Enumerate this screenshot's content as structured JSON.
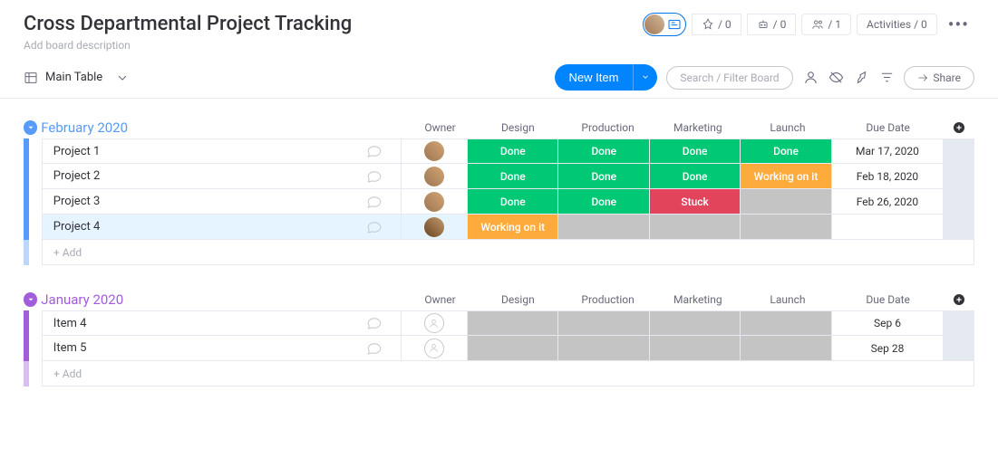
{
  "header": {
    "title": "Cross Departmental Project Tracking",
    "description": "Add board description",
    "stats": {
      "pin": "0",
      "bot": "0",
      "members": "1"
    },
    "activities_label": "Activities / 0"
  },
  "toolbar": {
    "view": "Main Table",
    "new_item": "New Item",
    "search_placeholder": "Search / Filter Board",
    "share": "Share"
  },
  "columns": {
    "owner": "Owner",
    "design": "Design",
    "production": "Production",
    "marketing": "Marketing",
    "launch": "Launch",
    "due_date": "Due Date"
  },
  "status_labels": {
    "done": "Done",
    "working": "Working on it",
    "stuck": "Stuck"
  },
  "common": {
    "add": "+ Add"
  },
  "groups": [
    {
      "id": "feb",
      "name": "February 2020",
      "color_class": "g-feb",
      "rows": [
        {
          "name": "Project 1",
          "owner": "photo1",
          "design": "done",
          "production": "done",
          "marketing": "done",
          "launch": "done",
          "due": "Mar 17, 2020",
          "selected": false
        },
        {
          "name": "Project 2",
          "owner": "photo1",
          "design": "done",
          "production": "done",
          "marketing": "done",
          "launch": "working",
          "due": "Feb 18, 2020",
          "selected": false
        },
        {
          "name": "Project 3",
          "owner": "photo1",
          "design": "done",
          "production": "done",
          "marketing": "stuck",
          "launch": "empty",
          "due": "Feb 26, 2020",
          "selected": false
        },
        {
          "name": "Project 4",
          "owner": "photo2",
          "design": "working",
          "production": "empty",
          "marketing": "empty",
          "launch": "empty",
          "due": "",
          "selected": true
        }
      ]
    },
    {
      "id": "jan",
      "name": "January 2020",
      "color_class": "g-jan",
      "rows": [
        {
          "name": "Item 4",
          "owner": "empty",
          "design": "empty",
          "production": "empty",
          "marketing": "empty",
          "launch": "empty",
          "due": "Sep 6",
          "selected": false
        },
        {
          "name": "Item 5",
          "owner": "empty",
          "design": "empty",
          "production": "empty",
          "marketing": "empty",
          "launch": "empty",
          "due": "Sep 28",
          "selected": false
        }
      ]
    }
  ]
}
